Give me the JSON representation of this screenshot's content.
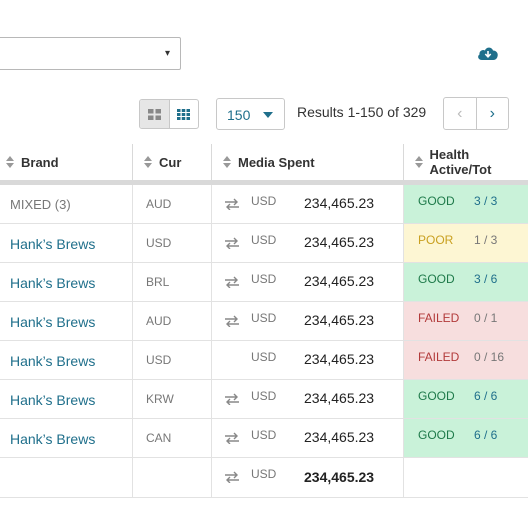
{
  "toolbar": {
    "select_caret": "▾",
    "page_size": "150",
    "results_text": "Results 1-150 of 329",
    "prev": "‹",
    "next": "›"
  },
  "columns": {
    "brand": "Brand",
    "cur": "Cur",
    "media_spent": "Media Spent",
    "health": "Health Active/Tot"
  },
  "rows": [
    {
      "brand": "MIXED (3)",
      "cur": "AUD",
      "transfer": true,
      "ccy": "USD",
      "amount": "234,465.23",
      "status": "GOOD",
      "ratio": "3 / 3"
    },
    {
      "brand": "Hank’s Brews",
      "cur": "USD",
      "transfer": true,
      "ccy": "USD",
      "amount": "234,465.23",
      "status": "POOR",
      "ratio": "1 / 3"
    },
    {
      "brand": "Hank’s Brews",
      "cur": "BRL",
      "transfer": true,
      "ccy": "USD",
      "amount": "234,465.23",
      "status": "GOOD",
      "ratio": "3 / 6"
    },
    {
      "brand": "Hank’s Brews",
      "cur": "AUD",
      "transfer": true,
      "ccy": "USD",
      "amount": "234,465.23",
      "status": "FAILED",
      "ratio": "0 / 1"
    },
    {
      "brand": "Hank’s Brews",
      "cur": "USD",
      "transfer": false,
      "ccy": "USD",
      "amount": "234,465.23",
      "status": "FAILED",
      "ratio": "0 / 16"
    },
    {
      "brand": "Hank’s Brews",
      "cur": "KRW",
      "transfer": true,
      "ccy": "USD",
      "amount": "234,465.23",
      "status": "GOOD",
      "ratio": "6 / 6"
    },
    {
      "brand": "Hank’s Brews",
      "cur": "CAN",
      "transfer": true,
      "ccy": "USD",
      "amount": "234,465.23",
      "status": "GOOD",
      "ratio": "6 / 6"
    }
  ],
  "total": {
    "ccy": "USD",
    "amount": "234,465.23"
  },
  "colors": {
    "good_bg": "#c9f2d9",
    "poor_bg": "#fdf6d3",
    "failed_bg": "#f7dede",
    "accent": "#1f6f8b"
  }
}
